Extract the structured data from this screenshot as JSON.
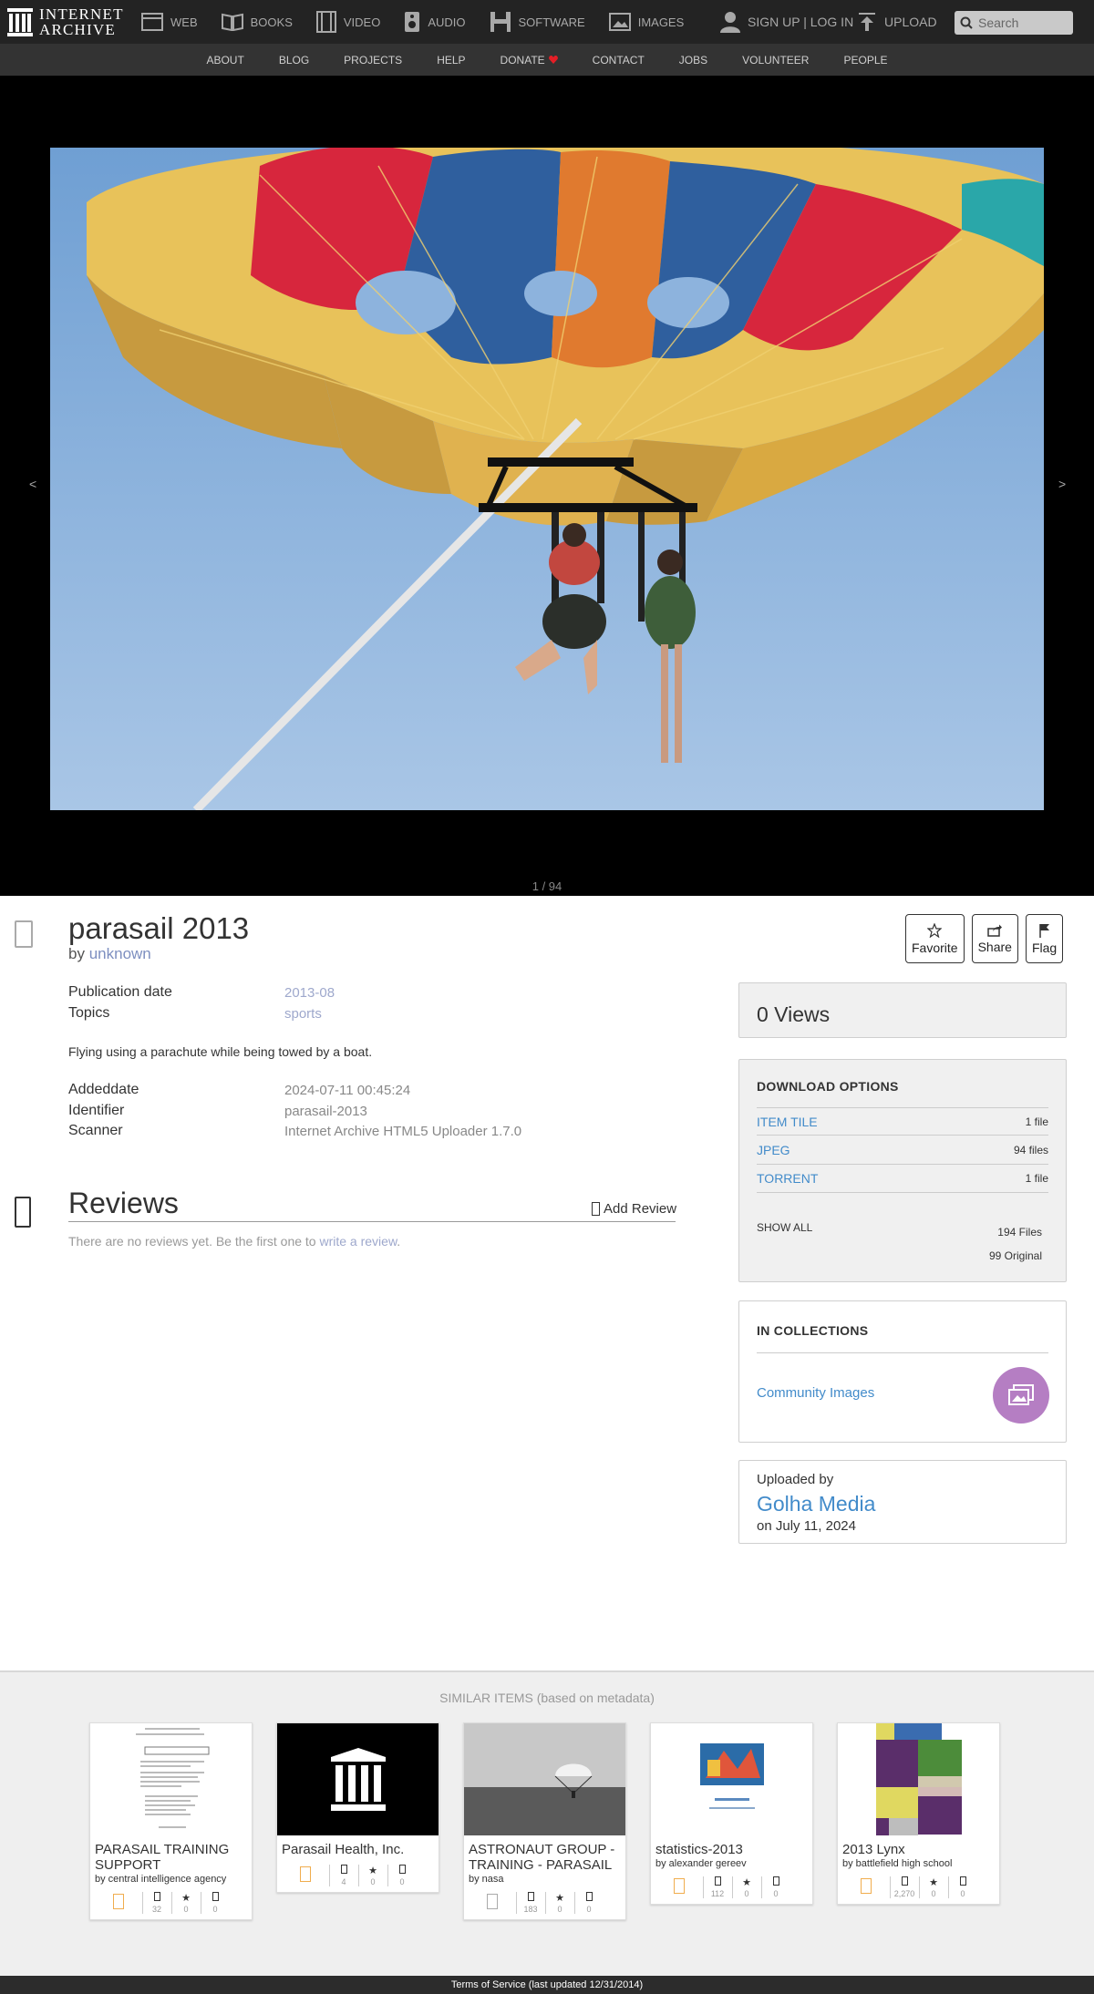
{
  "nav": {
    "logo_line1": "INTERNET",
    "logo_line2": "ARCHIVE",
    "media": [
      {
        "label": "WEB",
        "icon": "web-icon"
      },
      {
        "label": "BOOKS",
        "icon": "books-icon"
      },
      {
        "label": "VIDEO",
        "icon": "video-icon"
      },
      {
        "label": "AUDIO",
        "icon": "audio-icon"
      },
      {
        "label": "SOFTWARE",
        "icon": "software-icon"
      },
      {
        "label": "IMAGES",
        "icon": "images-icon"
      }
    ],
    "signup": "SIGN UP | LOG IN",
    "upload": "UPLOAD",
    "search_placeholder": "Search"
  },
  "subnav": [
    "ABOUT",
    "BLOG",
    "PROJECTS",
    "HELP",
    "DONATE",
    "CONTACT",
    "JOBS",
    "VOLUNTEER",
    "PEOPLE"
  ],
  "theater": {
    "prev": "<",
    "next": ">",
    "pager": "1 / 94"
  },
  "item": {
    "title": "parasail 2013",
    "by_prefix": "by",
    "creator": "unknown",
    "actions": {
      "favorite": "Favorite",
      "share": "Share",
      "flag": "Flag"
    },
    "metadata": [
      {
        "label": "Publication date",
        "value": "2013-08",
        "link": true
      },
      {
        "label": "Topics",
        "value": "sports",
        "link": true
      }
    ],
    "description": "Flying using a parachute while being towed by a boat.",
    "metadata2": [
      {
        "label": "Addeddate",
        "value": "2024-07-11 00:45:24"
      },
      {
        "label": "Identifier",
        "value": "parasail-2013"
      },
      {
        "label": "Scanner",
        "value": "Internet Archive HTML5 Uploader 1.7.0"
      }
    ]
  },
  "reviews": {
    "title": "Reviews",
    "add": "Add Review",
    "empty_text": "There are no reviews yet. Be the first one to",
    "empty_link": "write a review",
    "empty_end": "."
  },
  "sidebar": {
    "views": "0 Views",
    "download": {
      "heading": "DOWNLOAD OPTIONS",
      "rows": [
        {
          "format": "ITEM TILE",
          "count": "1 file"
        },
        {
          "format": "JPEG",
          "count": "94 files"
        },
        {
          "format": "TORRENT",
          "count": "1 file"
        }
      ],
      "show_all": "SHOW ALL",
      "total_files": "194 Files",
      "original": "99 Original"
    },
    "collections": {
      "heading": "IN COLLECTIONS",
      "name": "Community Images"
    },
    "uploader": {
      "label": "Uploaded by",
      "name": "Golha Media",
      "date": "on July 11, 2024"
    }
  },
  "similar": {
    "title": "SIMILAR ITEMS",
    "subtitle": "(based on metadata)",
    "items": [
      {
        "title": "PARASAIL TRAINING SUPPORT",
        "by": "by central intelligence agency",
        "views": "32",
        "favs": "0",
        "reviews": "0"
      },
      {
        "title": "Parasail Health, Inc.",
        "by": "",
        "views": "4",
        "favs": "0",
        "reviews": "0"
      },
      {
        "title": "ASTRONAUT GROUP - TRAINING - PARASAIL",
        "by": "by nasa",
        "views": "183",
        "favs": "0",
        "reviews": "0"
      },
      {
        "title": "statistics-2013",
        "by": "by alexander gereev",
        "views": "112",
        "favs": "0",
        "reviews": "0"
      },
      {
        "title": "2013 Lynx",
        "by": "by battlefield high school",
        "views": "2,270",
        "favs": "0",
        "reviews": "0"
      }
    ]
  },
  "footer": "Terms of Service (last updated 12/31/2014)",
  "colors": {
    "link": "#428bca",
    "nav_bg": "#232323",
    "subnav_bg": "#333333",
    "collection_badge": "#b57ec3"
  }
}
